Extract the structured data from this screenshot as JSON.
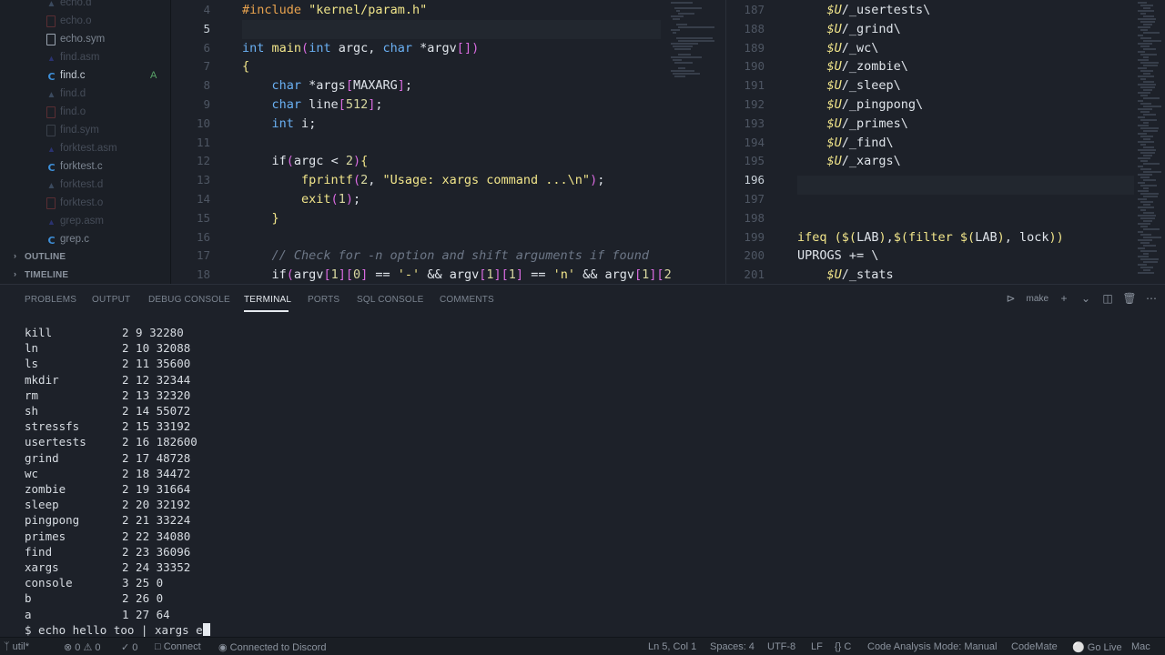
{
  "explorer": {
    "files": [
      {
        "name": "echo.d",
        "icon": "d-file-icon",
        "style": "dim"
      },
      {
        "name": "echo.o",
        "icon": "object-file-icon",
        "style": "dim"
      },
      {
        "name": "echo.sym",
        "icon": "file-icon",
        "style": "mid"
      },
      {
        "name": "find.asm",
        "icon": "asm-file-icon",
        "style": "dim"
      },
      {
        "name": "find.c",
        "icon": "c-file-icon",
        "style": "bright",
        "badge": "A"
      },
      {
        "name": "find.d",
        "icon": "d-file-icon",
        "style": "dim"
      },
      {
        "name": "find.o",
        "icon": "object-file-icon",
        "style": "dim"
      },
      {
        "name": "find.sym",
        "icon": "file-icon",
        "style": "dim"
      },
      {
        "name": "forktest.asm",
        "icon": "asm-file-icon",
        "style": "dim"
      },
      {
        "name": "forktest.c",
        "icon": "c-file-icon",
        "style": "mid"
      },
      {
        "name": "forktest.d",
        "icon": "d-file-icon",
        "style": "dim"
      },
      {
        "name": "forktest.o",
        "icon": "object-file-icon",
        "style": "dim"
      },
      {
        "name": "grep.asm",
        "icon": "asm-file-icon",
        "style": "dim"
      },
      {
        "name": "grep.c",
        "icon": "c-file-icon",
        "style": "mid"
      }
    ],
    "sections": [
      "OUTLINE",
      "TIMELINE"
    ]
  },
  "editor_left": {
    "active_line": "5",
    "lines": [
      {
        "n": "4",
        "code": "#include \"kernel/param.h\""
      },
      {
        "n": "5",
        "code": ""
      },
      {
        "n": "6",
        "code": "int main(int argc, char *argv[])"
      },
      {
        "n": "7",
        "code": "{"
      },
      {
        "n": "8",
        "code": "    char *args[MAXARG];"
      },
      {
        "n": "9",
        "code": "    char line[512];"
      },
      {
        "n": "10",
        "code": "    int i;"
      },
      {
        "n": "11",
        "code": ""
      },
      {
        "n": "12",
        "code": "    if(argc < 2){"
      },
      {
        "n": "13",
        "code": "        fprintf(2, \"Usage: xargs command ...\\n\");"
      },
      {
        "n": "14",
        "code": "        exit(1);"
      },
      {
        "n": "15",
        "code": "    }"
      },
      {
        "n": "16",
        "code": ""
      },
      {
        "n": "17",
        "code": "    // Check for -n option and shift arguments if found"
      },
      {
        "n": "18",
        "code": "    if(argv[1][0] == '-' && argv[1][1] == 'n' && argv[1][2"
      }
    ]
  },
  "editor_right": {
    "active_line": "196",
    "lines": [
      {
        "n": "187",
        "code": "    $U/_usertests\\"
      },
      {
        "n": "188",
        "code": "    $U/_grind\\"
      },
      {
        "n": "189",
        "code": "    $U/_wc\\"
      },
      {
        "n": "190",
        "code": "    $U/_zombie\\"
      },
      {
        "n": "191",
        "code": "    $U/_sleep\\"
      },
      {
        "n": "192",
        "code": "    $U/_pingpong\\"
      },
      {
        "n": "193",
        "code": "    $U/_primes\\"
      },
      {
        "n": "194",
        "code": "    $U/_find\\"
      },
      {
        "n": "195",
        "code": "    $U/_xargs\\"
      },
      {
        "n": "196",
        "code": ""
      },
      {
        "n": "197",
        "code": ""
      },
      {
        "n": "198",
        "code": ""
      },
      {
        "n": "199",
        "code": "ifeq ($(LAB),$(filter $(LAB), lock))"
      },
      {
        "n": "200",
        "code": "UPROGS += \\"
      },
      {
        "n": "201",
        "code": "    $U/_stats"
      }
    ]
  },
  "panel": {
    "tabs": [
      "PROBLEMS",
      "OUTPUT",
      "DEBUG CONSOLE",
      "TERMINAL",
      "PORTS",
      "SQL CONSOLE",
      "COMMENTS"
    ],
    "active_tab": "TERMINAL",
    "terminal_name": "make"
  },
  "terminal": {
    "rows": [
      {
        "name": "kill",
        "meta": "2 9 32280"
      },
      {
        "name": "ln",
        "meta": "2 10 32088"
      },
      {
        "name": "ls",
        "meta": "2 11 35600"
      },
      {
        "name": "mkdir",
        "meta": "2 12 32344"
      },
      {
        "name": "rm",
        "meta": "2 13 32320"
      },
      {
        "name": "sh",
        "meta": "2 14 55072"
      },
      {
        "name": "stressfs",
        "meta": "2 15 33192"
      },
      {
        "name": "usertests",
        "meta": "2 16 182600"
      },
      {
        "name": "grind",
        "meta": "2 17 48728"
      },
      {
        "name": "wc",
        "meta": "2 18 34472"
      },
      {
        "name": "zombie",
        "meta": "2 19 31664"
      },
      {
        "name": "sleep",
        "meta": "2 20 32192"
      },
      {
        "name": "pingpong",
        "meta": "2 21 33224"
      },
      {
        "name": "primes",
        "meta": "2 22 34080"
      },
      {
        "name": "find",
        "meta": "2 23 36096"
      },
      {
        "name": "xargs",
        "meta": "2 24 33352"
      },
      {
        "name": "console",
        "meta": "3 25 0"
      },
      {
        "name": "b",
        "meta": "2 26 0"
      },
      {
        "name": "a",
        "meta": "1 27 64"
      }
    ],
    "prompt_line": "$ echo hello too | xargs e"
  },
  "statusbar": {
    "branch": "util*",
    "problems": "0",
    "warnings": "0",
    "info": "0",
    "connect": "Connect",
    "discord": "Connected to Discord",
    "position": "Ln 5, Col 1",
    "spaces": "Spaces: 4",
    "encoding": "UTF-8",
    "eol": "LF",
    "language": "C",
    "analysis": "Code Analysis Mode: Manual",
    "codemate": "CodeMate",
    "golive": "Go Live",
    "platform": "Mac"
  }
}
